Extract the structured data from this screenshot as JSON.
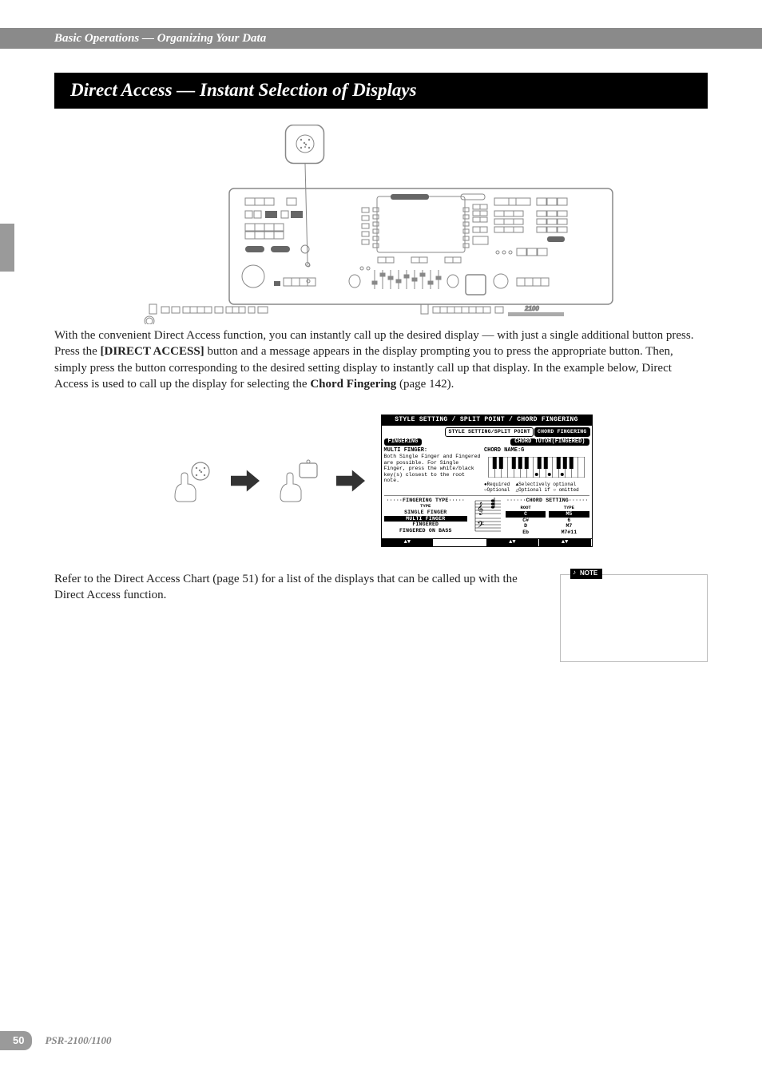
{
  "header": {
    "breadcrumb": "Basic Operations — Organizing Your Data"
  },
  "section": {
    "title": "Direct Access — Instant Selection of Displays"
  },
  "body": {
    "para1": "With the convenient Direct Access function, you can instantly call up the desired display — with just a single additional button press. Press the ",
    "para1_bold1": "[DIRECT ACCESS]",
    "para1_cont": " button and a message appears in the display prompting you to press the appropriate button. Then, simply press the button corresponding to the desired setting display to instantly call up that display. In the example below, Direct Access is used to call up the display for selecting the ",
    "para1_bold2": "Chord Fingering",
    "para1_end": " (page 142).",
    "note_text": "Refer to the Direct Access Chart (page 51) for a list of the displays that can be called up with the Direct Access function.",
    "note_label": "NOTE"
  },
  "lcd": {
    "title": "STYLE SETTING / SPLIT POINT / CHORD FINGERING",
    "tabs": {
      "inactive": "STYLE SETTING/SPLIT POINT",
      "active": "CHORD FINGERING"
    },
    "fingering_label": "FINGERING",
    "chord_tutor_label": "CHORD TUTOR(FINGERED)",
    "multifinger_label": "MULTI FINGER:",
    "fingering_desc": "Both Single Finger and Fingered are possible. For Single Finger, press the white/black key(s) closest to the root note.",
    "chord_name_label": "CHORD NAME:",
    "chord_name_value": "G",
    "legend_required": "●Required",
    "legend_sel_opt": "▲Selectively optional",
    "legend_optional": "○Optional",
    "legend_opt_if": "△Optional if ○ omitted",
    "fingering_type_title": "FINGERING TYPE",
    "type_subtitle": "TYPE",
    "fingering_types": [
      "SINGLE FINGER",
      "MULTI FINGER",
      "FINGERED",
      "FINGERED ON BASS"
    ],
    "fingering_selected_index": 1,
    "chord_setting_title": "CHORD SETTING",
    "root_label": "ROOT",
    "type_label": "TYPE",
    "roots": [
      "C",
      "C#",
      "D",
      "Eb"
    ],
    "types": [
      "M5",
      "6",
      "M7",
      "M7#11"
    ],
    "root_selected_index": 0,
    "type_selected_index": 0,
    "footer_arrows": "▲▼"
  },
  "footer": {
    "page": "50",
    "model": "PSR-2100/1100"
  }
}
